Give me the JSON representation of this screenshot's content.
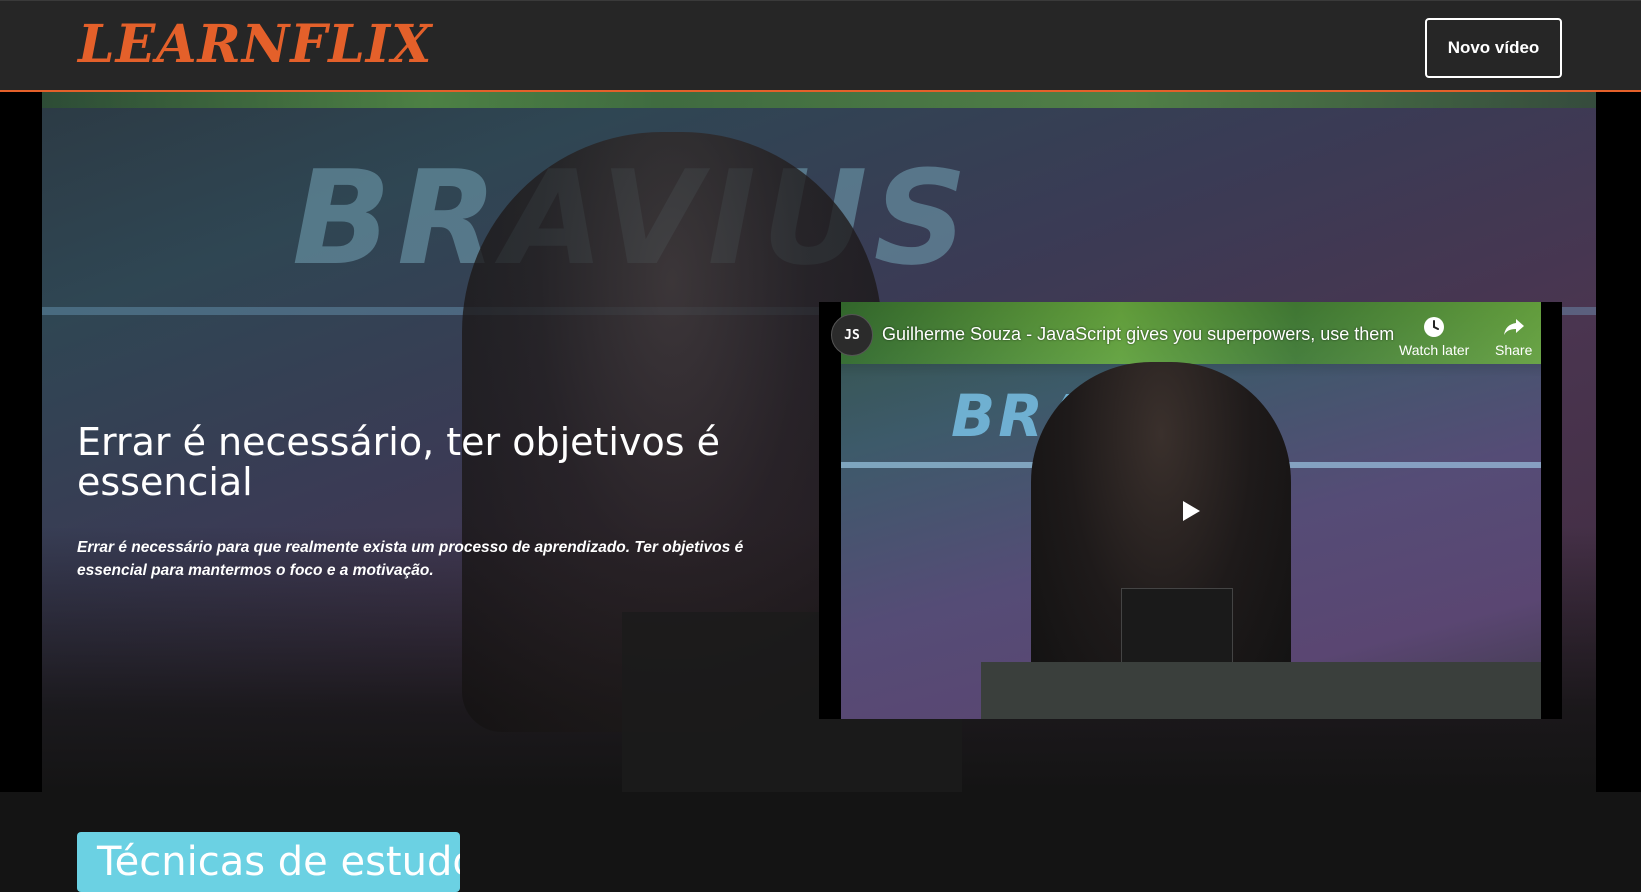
{
  "header": {
    "logo_text": "LEARNFLIX",
    "new_video_label": "Novo vídeo"
  },
  "banner": {
    "title": "Errar é necessário, ter objetivos é essencial",
    "description": "Errar é necessário para que realmente exista um processo de aprendizado. Ter objetivos é essencial para mantermos o foco e a motivação.",
    "background_brand_text": "BRAVIUS"
  },
  "video": {
    "title": "Guilherme Souza - JavaScript gives you superpowers, use them",
    "channel_avatar_text": "JS",
    "watch_later_label": "Watch later",
    "share_label": "Share",
    "brand_text": "BRAVIUS"
  },
  "category": {
    "label": "Técnicas de estudo"
  },
  "colors": {
    "accent": "#e4602a",
    "header_bg": "#262626",
    "page_bg": "#141414",
    "category_bg": "#6bd1e3"
  },
  "icons": {
    "watch_later": "clock-icon",
    "share": "share-arrow-icon",
    "play": "play-icon"
  }
}
